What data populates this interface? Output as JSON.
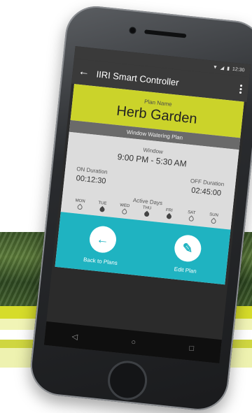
{
  "status": {
    "time": "12:30"
  },
  "appbar": {
    "back_icon": "arrow-left-icon",
    "title": "IIRI Smart Controller",
    "menu_icon": "more-vert-icon"
  },
  "plan": {
    "label": "Plan Name",
    "name": "Herb Garden",
    "type": "Window Watering Plan"
  },
  "window": {
    "label": "Window",
    "value": "9:00 PM - 5:30 AM"
  },
  "on_duration": {
    "label": "ON Duration",
    "value": "00:12:30"
  },
  "off_duration": {
    "label": "OFF Duration",
    "value": "02:45:00"
  },
  "active_days": {
    "label": "Active Days",
    "days": [
      {
        "name": "MON",
        "active": false
      },
      {
        "name": "TUE",
        "active": true
      },
      {
        "name": "WED",
        "active": false
      },
      {
        "name": "THU",
        "active": true
      },
      {
        "name": "FRI",
        "active": true
      },
      {
        "name": "SAT",
        "active": false
      },
      {
        "name": "SUN",
        "active": false
      }
    ]
  },
  "actions": {
    "back_label": "Back to Plans",
    "edit_label": "Edit Plan"
  },
  "colors": {
    "accent_yellow": "#cbd32a",
    "accent_teal": "#1fb3c1",
    "appbar": "#3a3a3a"
  }
}
